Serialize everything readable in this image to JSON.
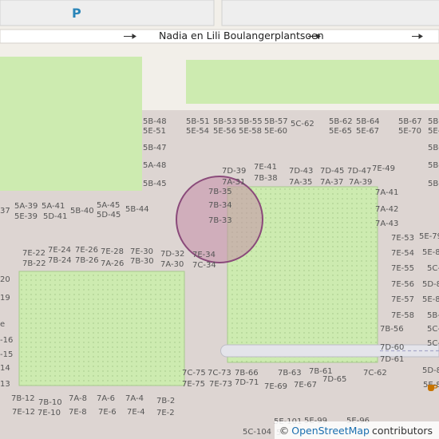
{
  "map": {
    "street_name": "Nadia en Lili Boulangerplantsoen",
    "parking_symbol": "P",
    "attribution": {
      "copyright": "©",
      "link_text": "OpenStreetMap",
      "suffix": "contributors"
    },
    "colors": {
      "land": "#f2efe9",
      "residential": "#ddd5d2",
      "park": "#cdebb0",
      "park_dotted": "#c8f0a8",
      "road": "#ffffff",
      "marker_fill": "#c28ea8",
      "marker_stroke": "#8a4a7a",
      "footway": "#e2e2e8"
    },
    "house_numbers": [
      "5B-48",
      "5E-51",
      "5B-51",
      "5E-54",
      "5B-53",
      "5E-56",
      "5B-55",
      "5E-58",
      "5B-57",
      "5E-60",
      "5C-62",
      "5B-62",
      "5E-65",
      "5B-64",
      "5E-67",
      "5B-67",
      "5E-70",
      "5B-",
      "5E-",
      "5B-47",
      "5A-48",
      "5B-45",
      "5B-",
      "5B-",
      "5B-",
      "7D-39",
      "7E-41",
      "7A-31",
      "7B-38",
      "7D-43",
      "7A-35",
      "7D-45",
      "7A-37",
      "7D-47",
      "7A-39",
      "7E-49",
      "7B-35",
      "7B-34",
      "7B-33",
      "7A-41",
      "7A-42",
      "7A-43",
      "5A-39",
      "5E-39",
      "5A-41",
      "5D-41",
      "5B-40",
      "5A-45",
      "5D-45",
      "5B-44",
      "37",
      "7E-22",
      "7B-22",
      "7E-24",
      "7B-24",
      "7E-26",
      "7B-26",
      "7E-28",
      "7A-26",
      "7E-30",
      "7B-30",
      "7D-32",
      "7A-30",
      "7E-34",
      "7C-34",
      "7E-53",
      "5E-79",
      "7E-54",
      "5E-8",
      "7E-55",
      "5C-",
      "7E-56",
      "5D-8",
      "7E-57",
      "5E-8",
      "7E-58",
      "5B-8",
      "7B-56",
      "5C-",
      "7D-60",
      "5C-",
      "7D-61",
      "5D-8",
      "5E-8",
      "20",
      "19",
      "e",
      "-16",
      "-15",
      "14",
      "13",
      "7C-75",
      "7E-75",
      "7C-73",
      "7E-73",
      "7B-66",
      "7D-71",
      "7B-63",
      "7E-69",
      "7B-61",
      "7E-67",
      "7D-65",
      "7C-62",
      "7B-12",
      "7E-12",
      "7B-10",
      "7E-10",
      "7A-8",
      "7E-8",
      "7A-6",
      "7E-6",
      "7A-4",
      "7E-4",
      "7B-2",
      "7E-2",
      "5E-101",
      "5E-99",
      "5E-96",
      "5C-104",
      "5"
    ],
    "icons": [
      "location-marker-icon",
      "cafe-icon",
      "oneway-arrow-icon"
    ]
  }
}
